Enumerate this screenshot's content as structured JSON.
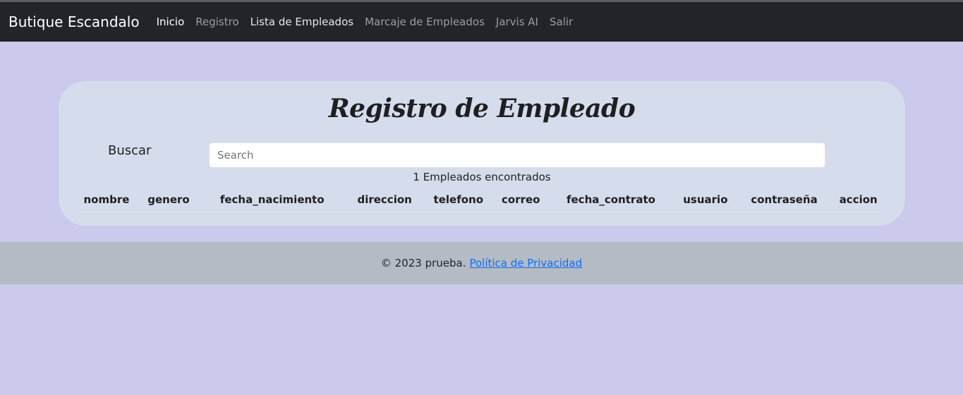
{
  "navbar": {
    "brand": "Butique Escandalo",
    "links": [
      {
        "label": "Inicio"
      },
      {
        "label": "Registro"
      },
      {
        "label": "Lista de Empleados"
      },
      {
        "label": "Marcaje de Empleados"
      },
      {
        "label": "Jarvis AI"
      },
      {
        "label": "Salir"
      }
    ],
    "bg_color": "#212529"
  },
  "main": {
    "title": "Registro de Empleado",
    "search": {
      "label": "Buscar",
      "placeholder": "Search",
      "value": ""
    },
    "result_count": "1 Empleados encontrados",
    "table": {
      "headers": [
        "nombre",
        "genero",
        "fecha_nacimiento",
        "direccion",
        "telefono",
        "correo",
        "fecha_contrato",
        "usuario",
        "contraseña",
        "accion"
      ],
      "rows": []
    },
    "page_bg_color": "#cbc9ec",
    "card_bg_color": "#d5dcec"
  },
  "footer": {
    "text": "© 2023 prueba.",
    "link_label": "Política de Privacidad",
    "bg_color": "#b4bbc3",
    "link_color": "#0d6efd"
  }
}
